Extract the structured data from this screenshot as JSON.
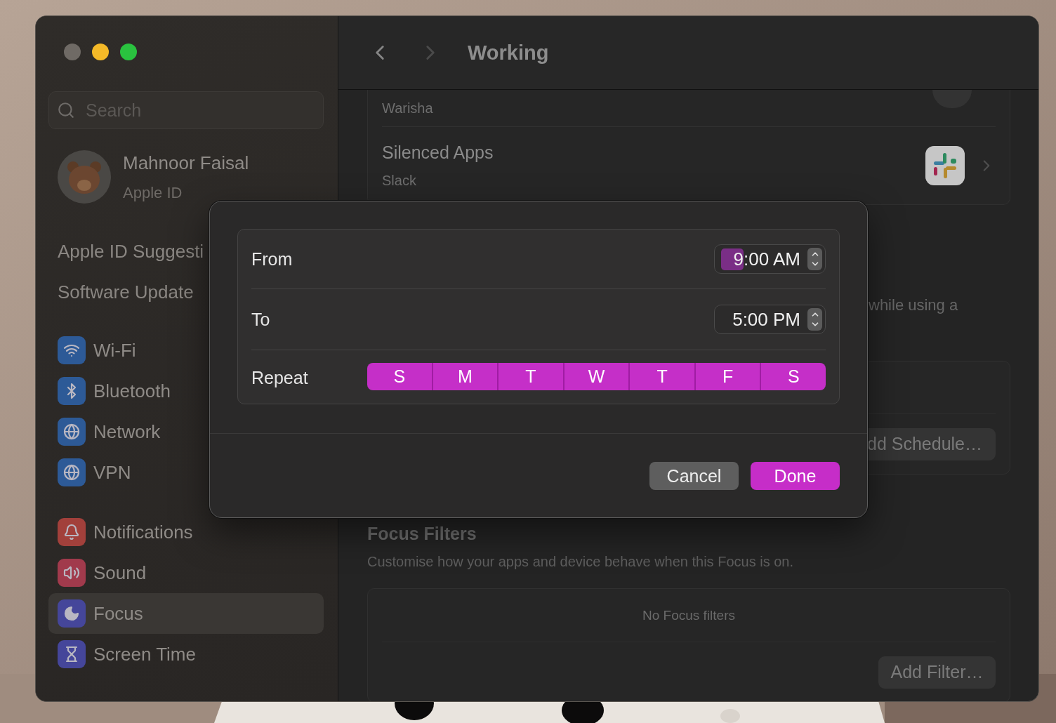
{
  "window": {
    "traffic_lights": [
      {
        "color": "#6f6a65"
      },
      {
        "color": "#f4b928"
      },
      {
        "color": "#2ac23f"
      }
    ]
  },
  "sidebar": {
    "search": {
      "placeholder": "Search"
    },
    "account": {
      "name": "Mahnoor Faisal",
      "subtitle": "Apple ID"
    },
    "links": [
      "Apple ID Suggesti",
      "Software Update"
    ],
    "groups": [
      [
        {
          "label": "Wi-Fi",
          "color": "#2d5a97",
          "selected": false
        },
        {
          "label": "Bluetooth",
          "color": "#2d5a97",
          "selected": false
        },
        {
          "label": "Network",
          "color": "#2d5a97",
          "selected": false
        },
        {
          "label": "VPN",
          "color": "#2d5a97",
          "selected": false
        }
      ],
      [
        {
          "label": "Notifications",
          "color": "#a2403b",
          "selected": false
        },
        {
          "label": "Sound",
          "color": "#a13a4c",
          "selected": false
        },
        {
          "label": "Focus",
          "color": "#45469a",
          "selected": true
        },
        {
          "label": "Screen Time",
          "color": "#45469a",
          "selected": false
        }
      ]
    ]
  },
  "content": {
    "title": "Working",
    "back_enabled": true,
    "forward_enabled": false,
    "people_row": {
      "subtitle": "Warisha"
    },
    "apps_row": {
      "title": "Silenced Apps",
      "subtitle": "Slack"
    },
    "schedule_note": "while using a",
    "schedule_button": "dd Schedule…",
    "filters": {
      "title": "Focus Filters",
      "description": "Customise how your apps and device behave when this Focus is on.",
      "empty": "No Focus filters",
      "button": "Add Filter…"
    }
  },
  "dialog": {
    "rows": [
      {
        "kind": "time",
        "label": "From",
        "hour": "9",
        "rest": ":00 AM",
        "hour_selected": true
      },
      {
        "kind": "time",
        "label": "To",
        "hour": "5",
        "rest": ":00 PM",
        "hour_selected": false
      },
      {
        "kind": "days",
        "label": "Repeat",
        "days": [
          {
            "label": "S",
            "selected": true
          },
          {
            "label": "M",
            "selected": true
          },
          {
            "label": "T",
            "selected": true
          },
          {
            "label": "W",
            "selected": true
          },
          {
            "label": "T",
            "selected": true
          },
          {
            "label": "F",
            "selected": true
          },
          {
            "label": "S",
            "selected": true
          }
        ]
      }
    ],
    "buttons": [
      {
        "label": "Cancel",
        "kind": "default"
      },
      {
        "label": "Done",
        "kind": "primary"
      }
    ]
  }
}
